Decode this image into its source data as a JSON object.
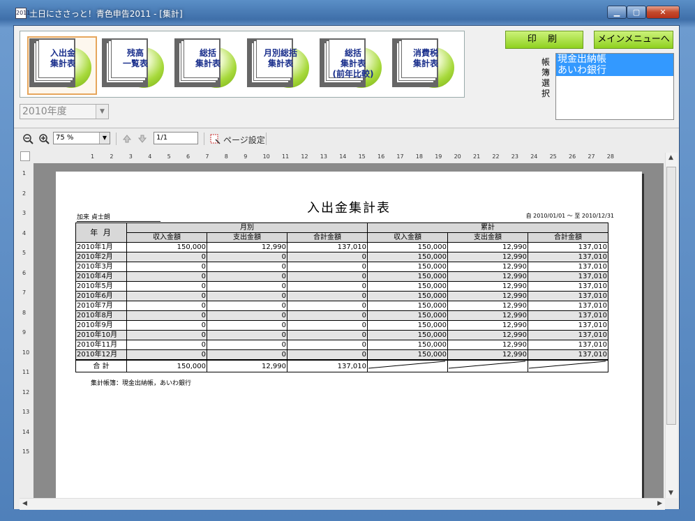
{
  "window": {
    "title": "土日にささっと！青色申告2011 - [集計]",
    "icon_label": "2011"
  },
  "report_buttons": [
    {
      "label": "入出金\n集計表",
      "selected": true
    },
    {
      "label": "残高\n一覧表",
      "selected": false
    },
    {
      "label": "総括\n集計表",
      "selected": false
    },
    {
      "label": "月別総括\n集計表",
      "selected": false
    },
    {
      "label": "総括\n集計表\n(前年比較)",
      "selected": false
    },
    {
      "label": "消費税\n集計表",
      "selected": false
    }
  ],
  "year_select": {
    "value": "2010年度"
  },
  "actions": {
    "print": "印 刷",
    "main_menu": "メインメニューへ"
  },
  "ledger": {
    "label": "帳簿選択",
    "items": [
      "現金出納帳",
      "あいわ銀行"
    ]
  },
  "viewer": {
    "zoom": "75 %",
    "page": "1/1",
    "page_setup": "ページ設定",
    "ruler_h": [
      "1",
      "2",
      "3",
      "4",
      "5",
      "6",
      "7",
      "8",
      "9",
      "10",
      "11",
      "12",
      "13",
      "14",
      "15",
      "16",
      "17",
      "18",
      "19",
      "20",
      "21",
      "22",
      "23",
      "24",
      "25",
      "26",
      "27",
      "28"
    ],
    "ruler_v": [
      "1",
      "2",
      "3",
      "4",
      "5",
      "6",
      "7",
      "8",
      "9",
      "10",
      "11",
      "12",
      "13",
      "14",
      "15"
    ]
  },
  "report": {
    "title": "入出金集計表",
    "party": "加来 貞士朗",
    "period": "自 2010/01/01 ～ 至 2010/12/31",
    "head_month": "年 月",
    "group_monthly": "月別",
    "group_cumulative": "累計",
    "col_income": "収入金額",
    "col_expense": "支出金額",
    "col_total": "合計金額",
    "rows": [
      {
        "month": "2010年1月",
        "m_in": "150,000",
        "m_out": "12,990",
        "m_sum": "137,010",
        "c_in": "150,000",
        "c_out": "12,990",
        "c_sum": "137,010"
      },
      {
        "month": "2010年2月",
        "m_in": "0",
        "m_out": "0",
        "m_sum": "0",
        "c_in": "150,000",
        "c_out": "12,990",
        "c_sum": "137,010"
      },
      {
        "month": "2010年3月",
        "m_in": "0",
        "m_out": "0",
        "m_sum": "0",
        "c_in": "150,000",
        "c_out": "12,990",
        "c_sum": "137,010"
      },
      {
        "month": "2010年4月",
        "m_in": "0",
        "m_out": "0",
        "m_sum": "0",
        "c_in": "150,000",
        "c_out": "12,990",
        "c_sum": "137,010"
      },
      {
        "month": "2010年5月",
        "m_in": "0",
        "m_out": "0",
        "m_sum": "0",
        "c_in": "150,000",
        "c_out": "12,990",
        "c_sum": "137,010"
      },
      {
        "month": "2010年6月",
        "m_in": "0",
        "m_out": "0",
        "m_sum": "0",
        "c_in": "150,000",
        "c_out": "12,990",
        "c_sum": "137,010"
      },
      {
        "month": "2010年7月",
        "m_in": "0",
        "m_out": "0",
        "m_sum": "0",
        "c_in": "150,000",
        "c_out": "12,990",
        "c_sum": "137,010"
      },
      {
        "month": "2010年8月",
        "m_in": "0",
        "m_out": "0",
        "m_sum": "0",
        "c_in": "150,000",
        "c_out": "12,990",
        "c_sum": "137,010"
      },
      {
        "month": "2010年9月",
        "m_in": "0",
        "m_out": "0",
        "m_sum": "0",
        "c_in": "150,000",
        "c_out": "12,990",
        "c_sum": "137,010"
      },
      {
        "month": "2010年10月",
        "m_in": "0",
        "m_out": "0",
        "m_sum": "0",
        "c_in": "150,000",
        "c_out": "12,990",
        "c_sum": "137,010"
      },
      {
        "month": "2010年11月",
        "m_in": "0",
        "m_out": "0",
        "m_sum": "0",
        "c_in": "150,000",
        "c_out": "12,990",
        "c_sum": "137,010"
      },
      {
        "month": "2010年12月",
        "m_in": "0",
        "m_out": "0",
        "m_sum": "0",
        "c_in": "150,000",
        "c_out": "12,990",
        "c_sum": "137,010"
      }
    ],
    "total": {
      "label": "合 計",
      "m_in": "150,000",
      "m_out": "12,990",
      "m_sum": "137,010"
    },
    "footnote": "集計帳簿：現金出納帳，あいわ銀行"
  }
}
